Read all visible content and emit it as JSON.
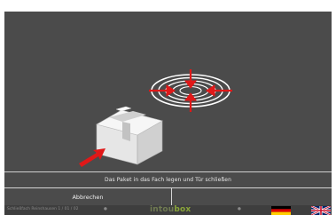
{
  "instruction": "Das Paket in das Fach legen und Tür schließen",
  "buttons": {
    "cancel_label": "Abbrechen"
  },
  "footer": {
    "left_text": "Schließfach Reinshausen 1 / 01 / 02",
    "left_marker": "●",
    "right_marker": "●",
    "brand_prefix": "intou",
    "brand_suffix": "box"
  },
  "languages": [
    {
      "code": "de",
      "icon": "german-flag-icon"
    },
    {
      "code": "en",
      "icon": "uk-flag-icon"
    }
  ],
  "colors": {
    "background": "#4b4b4b",
    "accent_arrow": "#e01818",
    "brand_green": "#8aa53a"
  }
}
